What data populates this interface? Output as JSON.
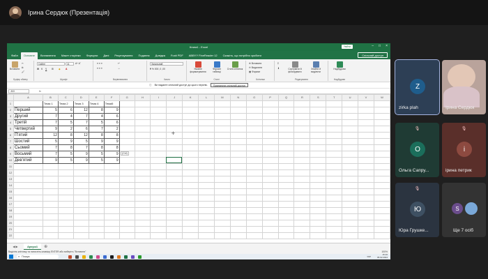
{
  "teams": {
    "presenter_title": "Ірина Сердюк (Презентація)"
  },
  "excel": {
    "window_title": "Книга1 - Excel",
    "search_placeholder": "Скажіть, що потрібно зробити",
    "user_badge": "Увійти",
    "tabs": [
      "Файл",
      "Основне",
      "Вставлення",
      "Макет сторінки",
      "Формули",
      "Дані",
      "Рецензування",
      "Подання",
      "Довідка",
      "Foxit PDF",
      "ABBYY FineReader 12"
    ],
    "active_tab": "Основне",
    "share_label": "Спільний доступ",
    "ribbon": {
      "paste": "Вставити",
      "clipboard_group": "Буфер обміну",
      "font_name": "Calibri",
      "font_size": "11",
      "font_group": "Шрифт",
      "alignment_group": "Вирівнювання",
      "number_format": "Загальний",
      "number_group": "Число",
      "conditional": "Умовне форматування",
      "format_table": "Формат таблиці",
      "cell_styles": "Стилі клітинок",
      "styles_group": "Стилі",
      "insert": "Вставити",
      "delete": "Видалити",
      "format": "Формат",
      "cells_group": "Клітинки",
      "sort": "Сортувати й фільтрувати",
      "find": "Знайти й виділити",
      "editing_group": "Редагування",
      "addins": "Надбудови",
      "addins_group": "Надбудови"
    },
    "infobar_text": "Ви надаєте спільний доступ до цього перелік.",
    "infobar_button": "Припинити спільний доступ",
    "name_box": "J10",
    "fx": "fx",
    "columns": [
      "A",
      "B",
      "C",
      "D",
      "E",
      "F",
      "G",
      "H",
      "I",
      "J",
      "K",
      "L",
      "M",
      "N",
      "O",
      "P",
      "Q",
      "R",
      "S",
      "T",
      "U",
      "V",
      "W"
    ],
    "header_row": [
      "",
      "Тема 1",
      "Тема 2",
      "Тема 3",
      "Тема 4",
      "Тема5"
    ],
    "rows": [
      {
        "name": "Перший",
        "values": [
          5,
          6,
          12,
          8,
          9
        ]
      },
      {
        "name": "Другий",
        "values": [
          7,
          4,
          7,
          4,
          6
        ]
      },
      {
        "name": "Третій",
        "values": [
          7,
          5,
          7,
          5,
          6
        ]
      },
      {
        "name": "Четвертий",
        "values": [
          9,
          2,
          6,
          7,
          2
        ]
      },
      {
        "name": "П'ятий",
        "values": [
          12,
          8,
          12,
          8,
          8
        ]
      },
      {
        "name": "Шостий",
        "values": [
          5,
          9,
          5,
          9,
          9
        ]
      },
      {
        "name": "Сьомий",
        "values": [
          7,
          8,
          7,
          8,
          8
        ]
      },
      {
        "name": "Восьмий",
        "values": [
          7,
          5,
          9,
          5,
          9
        ]
      },
      {
        "name": "Дев'ятий",
        "values": [
          9,
          5,
          9,
          5,
          9
        ]
      }
    ],
    "paste_tag": "(Ctrl)",
    "sheet_tab": "Аркуш1",
    "status_text": "Виділіть клітинку та натисніть клавішу ENTER або виберіть \"Вставити\"",
    "zoom": "100%"
  },
  "taskbar": {
    "search_placeholder": "Пошук",
    "lang": "УКР",
    "time": "15:16",
    "date": "05.02.2024"
  },
  "participants": [
    {
      "name": "zirka plah",
      "initial": "Z",
      "bg": "#2d3f55",
      "circle": "#1f5d8c",
      "muted": false
    },
    {
      "name": "Ірина Сердюк",
      "initial": "",
      "bg": "#b9a39b",
      "circle": "",
      "muted": false
    },
    {
      "name": "Ольга Сапру...",
      "initial": "О",
      "bg": "#1f3b34",
      "circle": "#1b6e5b",
      "muted": true
    },
    {
      "name": "ірина петрик",
      "initial": "і",
      "bg": "#5a2f2a",
      "circle": "#8d4a40",
      "muted": true
    },
    {
      "name": "Юра Грушке...",
      "initial": "Ю",
      "bg": "#2b3440",
      "circle": "#3e5062",
      "muted": true
    },
    {
      "name": "Ще 7 осіб",
      "initial": "S",
      "bg": "#333333",
      "circle": "#6b4d8c",
      "muted": false
    }
  ]
}
